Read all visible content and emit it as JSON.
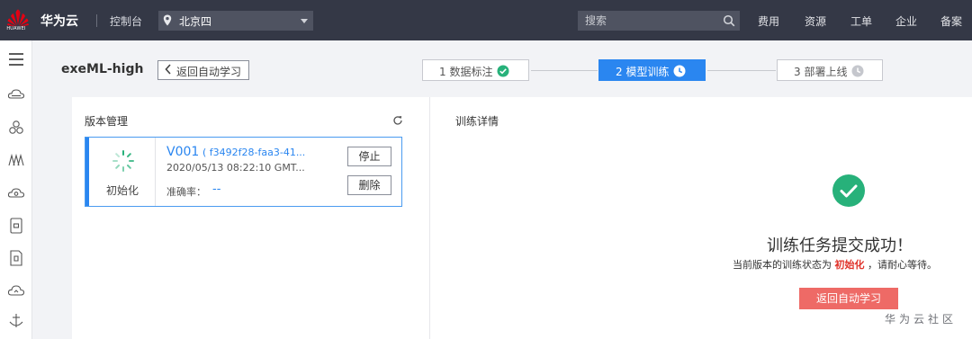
{
  "topbar": {
    "logo_text": "HUAWEI",
    "brand": "华为云",
    "console": "控制台",
    "region": "北京四",
    "search_placeholder": "搜索",
    "nav": [
      "费用",
      "资源",
      "工单",
      "企业",
      "备案"
    ]
  },
  "sidebar": {
    "icons": [
      "menu-icon",
      "cloud-server-icon",
      "cluster-icon",
      "ml-icon",
      "cloud-storage-icon",
      "document-icon",
      "document-alt-icon",
      "cloud-icon",
      "deploy-icon"
    ]
  },
  "header": {
    "title": "exeML-high",
    "back_label": "返回自动学习"
  },
  "steps": [
    {
      "label": "1 数据标注",
      "state": "done"
    },
    {
      "label": "2 模型训练",
      "state": "active"
    },
    {
      "label": "3 部署上线",
      "state": "pending"
    }
  ],
  "version_panel": {
    "title": "版本管理",
    "card": {
      "status": "初始化",
      "version": "V001",
      "id": "( f3492f28-faa3-41...",
      "time": "2020/05/13 08:22:10 GMT...",
      "accuracy_label": "准确率：",
      "accuracy_value": "--",
      "stop_label": "停止",
      "delete_label": "删除"
    }
  },
  "details": {
    "title": "训练详情",
    "success_title": "训练任务提交成功！",
    "desc_prefix": "当前版本的训练状态为",
    "desc_status": "初始化",
    "desc_suffix": "，请耐心等待。",
    "return_label": "返回自动学习"
  },
  "watermark": "华为云社区",
  "colors": {
    "topbar": "#343846",
    "primary": "#2a86f0",
    "success": "#27b17a",
    "danger": "#e0332b",
    "return_button": "#ee6a66"
  }
}
